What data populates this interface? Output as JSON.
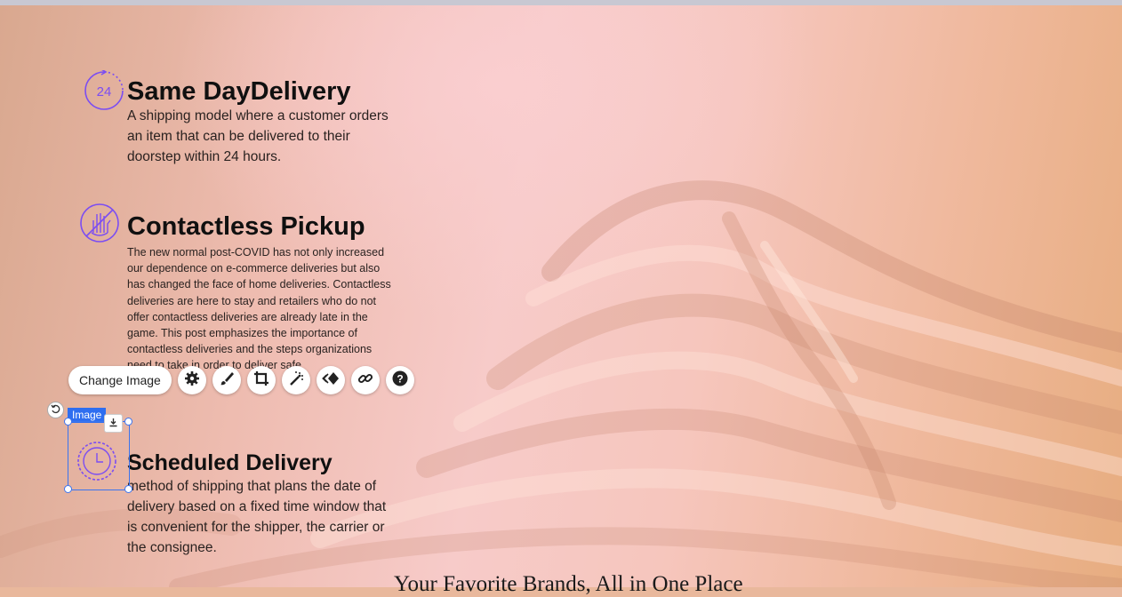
{
  "features": [
    {
      "title": "Same DayDelivery",
      "description": "A shipping model where a customer orders an item that can be delivered to their doorstep within 24 hours.",
      "icon": "24-hours-icon",
      "icon_text": "24"
    },
    {
      "title": "Contactless Pickup",
      "description": "The new normal post-COVID has not only increased our dependence on e-commerce deliveries but also has changed the face of home deliveries. Contactless deliveries are here to stay and retailers who do not offer contactless deliveries are already late in the game. This post emphasizes the importance of contactless deliveries and the steps organizations need to take in order to deliver safe",
      "icon": "no-hand-icon"
    },
    {
      "title": "Scheduled Delivery",
      "description": "method of shipping that plans the date of delivery based on a fixed time window that is convenient for the shipper, the carrier or the consignee.",
      "icon": "clock-icon"
    }
  ],
  "toolbar": {
    "change_image_label": "Change Image",
    "buttons": [
      "settings-icon",
      "brush-icon",
      "crop-icon",
      "magic-wand-icon",
      "animation-icon",
      "link-icon",
      "help-icon"
    ]
  },
  "selection": {
    "label": "Image"
  },
  "tagline": "Your Favorite Brands, All in One Place",
  "colors": {
    "accent": "#7b4df2",
    "selection": "#2e6ef0"
  }
}
